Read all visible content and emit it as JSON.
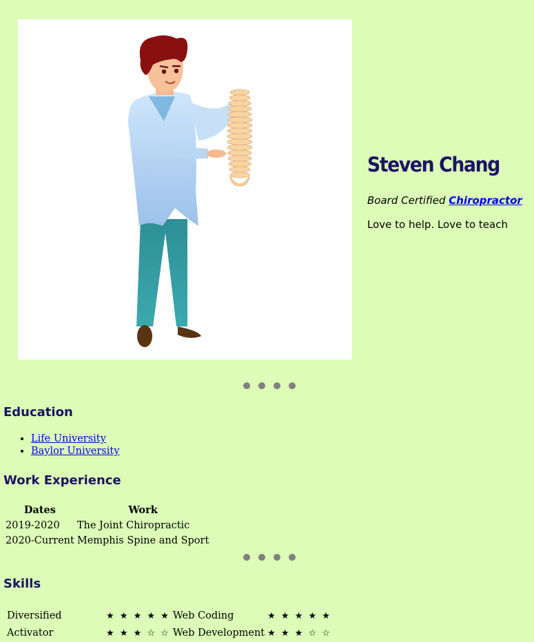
{
  "profile": {
    "name": "Steven Chang",
    "title_prefix": "Board Certified",
    "title_link": "Chiropractor",
    "tagline": "Love to help. Love to teach"
  },
  "hero_image": {
    "description": "illustration-chiropractor-holding-spine"
  },
  "education": {
    "heading": "Education",
    "items": [
      {
        "label": "Life University"
      },
      {
        "label": "Baylor University"
      }
    ]
  },
  "work": {
    "heading": "Work Experience",
    "columns": [
      "Dates",
      "Work"
    ],
    "rows": [
      {
        "dates": "2019-2020",
        "work": "The Joint Chiropractic"
      },
      {
        "dates": "2020-Current",
        "work": "Memphis Spine and Sport"
      }
    ]
  },
  "skills": {
    "heading": "Skills",
    "rows": [
      {
        "left_name": "Diversified",
        "left_stars": "★ ★ ★ ★ ★",
        "left_rating": 5,
        "right_name": "Web Coding",
        "right_stars": "★ ★ ★ ★ ★",
        "right_rating": 5
      },
      {
        "left_name": "Activator",
        "left_stars": "★ ★ ★ ☆ ☆",
        "left_rating": 3,
        "right_name": "Web Development",
        "right_stars": "★ ★ ★ ☆ ☆",
        "right_rating": 3
      }
    ]
  },
  "colors": {
    "background": "#dcfcb8",
    "heading": "#1b1464",
    "link": "#0000ee",
    "dots": "#808080"
  }
}
